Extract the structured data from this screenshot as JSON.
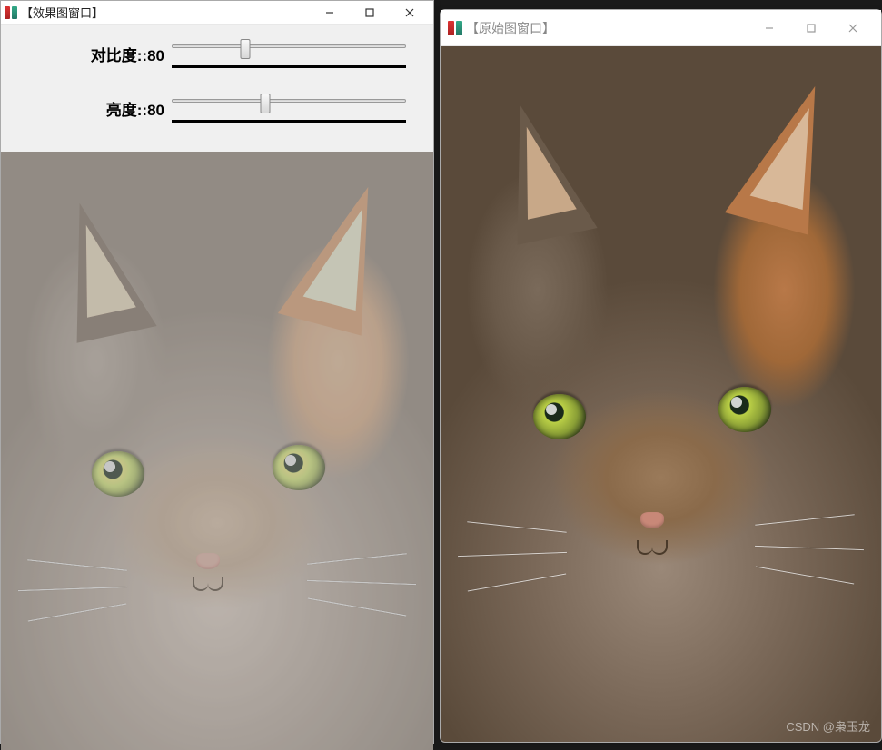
{
  "effect_window": {
    "title": "【效果图窗口】",
    "sliders": {
      "contrast": {
        "label": "对比度::80",
        "value": 80,
        "max": 255
      },
      "brightness": {
        "label": "亮度::80",
        "value": 80,
        "max": 200
      }
    }
  },
  "original_window": {
    "title": "【原始图窗口】"
  },
  "watermark": "CSDN @枭玉龙"
}
